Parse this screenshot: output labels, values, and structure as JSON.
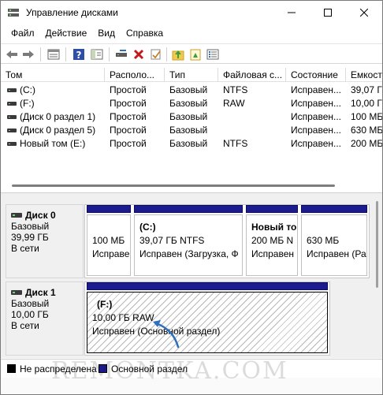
{
  "window": {
    "title": "Управление дисками",
    "minimize_icon": "minimize-icon",
    "maximize_icon": "maximize-icon",
    "close_icon": "close-icon"
  },
  "menu": [
    "Файл",
    "Действие",
    "Вид",
    "Справка"
  ],
  "toolbar": {
    "icons": [
      "back-icon",
      "forward-icon",
      "properties-list-icon",
      "help-icon",
      "console-tree-icon",
      "connect-drive-icon",
      "delete-icon",
      "check-icon",
      "import-folder-icon",
      "settings-list-icon"
    ]
  },
  "volumes": {
    "columns": [
      "Том",
      "Располо...",
      "Тип",
      "Файловая с...",
      "Состояние",
      "Емкост"
    ],
    "rows": [
      [
        "(C:)",
        "Простой",
        "Базовый",
        "NTFS",
        "Исправен...",
        "39,07 ГБ"
      ],
      [
        "(F:)",
        "Простой",
        "Базовый",
        "RAW",
        "Исправен...",
        "10,00 ГБ"
      ],
      [
        "(Диск 0 раздел 1)",
        "Простой",
        "Базовый",
        "",
        "Исправен...",
        "100 МБ"
      ],
      [
        "(Диск 0 раздел 5)",
        "Простой",
        "Базовый",
        "",
        "Исправен...",
        "630 МБ"
      ],
      [
        "Новый том (E:)",
        "Простой",
        "Базовый",
        "NTFS",
        "Исправен...",
        "200 МБ"
      ]
    ]
  },
  "disks": [
    {
      "name": "Диск 0",
      "type": "Базовый",
      "size": "39,99 ГБ",
      "status": "В сети",
      "partitions": [
        {
          "title": "",
          "line1": "100 МБ",
          "line2": "Исправен"
        },
        {
          "title": "(C:)",
          "line1": "39,07 ГБ NTFS",
          "line2": "Исправен (Загрузка, Ф"
        },
        {
          "title": "Новый то",
          "line1": "200 МБ N",
          "line2": "Исправен"
        },
        {
          "title": "",
          "line1": "630 МБ",
          "line2": "Исправен (Ра"
        }
      ]
    },
    {
      "name": "Диск 1",
      "type": "Базовый",
      "size": "10,00 ГБ",
      "status": "В сети",
      "partitions": [
        {
          "title": "(F:)",
          "line1": "10,00 ГБ RAW",
          "line2": "Исправен (Основной раздел)"
        }
      ]
    }
  ],
  "legend": {
    "unallocated": "Не распределена",
    "primary": "Основной раздел",
    "unallocated_color": "#000000",
    "primary_color": "#1c1c8f"
  },
  "watermark": "REMONTKA.COM",
  "colors": {
    "partition_header": "#1c1c8f",
    "selection_arrow": "#2f6fbf"
  }
}
